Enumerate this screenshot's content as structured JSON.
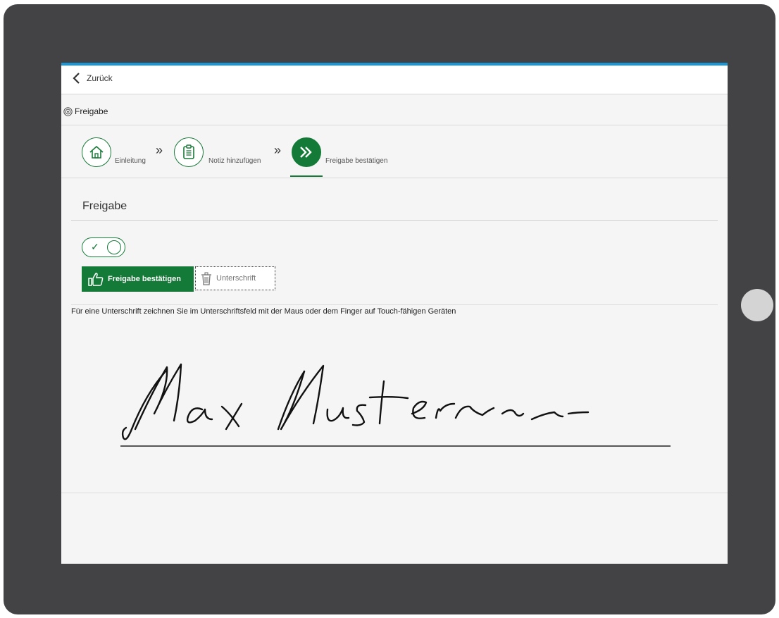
{
  "nav": {
    "back_label": "Zurück"
  },
  "breadcrumb": {
    "label": "Freigabe"
  },
  "steps": [
    {
      "label": "Einleitung",
      "icon": "home-icon",
      "active": false
    },
    {
      "label": "Notiz hinzufügen",
      "icon": "clipboard-icon",
      "active": false
    },
    {
      "label": "Freigabe bestätigen",
      "icon": "double-chevron-right-icon",
      "active": true
    }
  ],
  "section": {
    "title": "Freigabe"
  },
  "toggle": {
    "checked": true
  },
  "actions": {
    "confirm_label": "Freigabe bestätigen",
    "signature_label": "Unterschrift"
  },
  "hint": "Für eine Unterschrift zeichnen Sie im Unterschriftsfeld mit der Maus oder dem Finger auf Touch-fähigen Geräten",
  "signature": {
    "ink_color": "#111111"
  },
  "colors": {
    "brand_green": "#137a37",
    "accent_blue": "#1a96d4"
  }
}
